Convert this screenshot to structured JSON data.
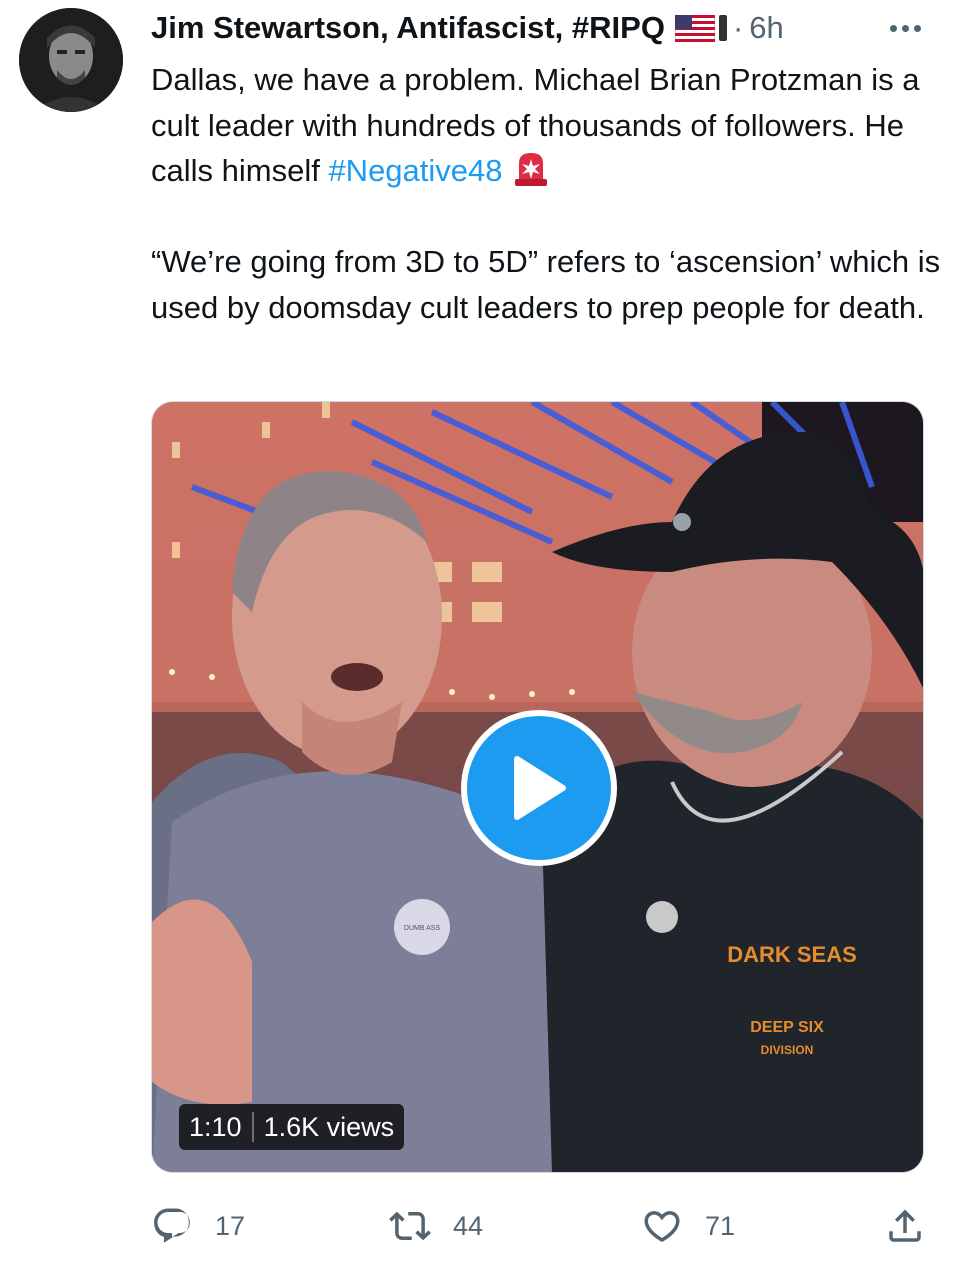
{
  "author": {
    "name": "Jim Stewartson, Antifascist, #RIPQ",
    "flag_icon": "us-flag-icon",
    "separator": "·",
    "time": "6h"
  },
  "tweet": {
    "text_1_before_hashtag": "Dallas, we have a problem. Michael Brian Protzman is a cult leader with hundreds of thousands of followers. He calls himself ",
    "hashtag": "#Negative48",
    "text_1_icon": "police-siren-icon",
    "text_2": "“We’re going from 3D to 5D” refers to ‘ascension’ which is used by doomsday cult leaders to prep people for death."
  },
  "media": {
    "duration": "1:10",
    "views": "1.6K views",
    "badge_text": "DUMB ASS",
    "shirt_text_top": "DARK SEAS",
    "shirt_text_mid": "DEEP SIX",
    "shirt_text_bottom": "DIVISION"
  },
  "actions": {
    "reply_count": "17",
    "retweet_count": "44",
    "like_count": "71"
  },
  "colors": {
    "link": "#1d9bf0",
    "secondary_text": "#536471",
    "play_button": "#1d9bf0"
  }
}
